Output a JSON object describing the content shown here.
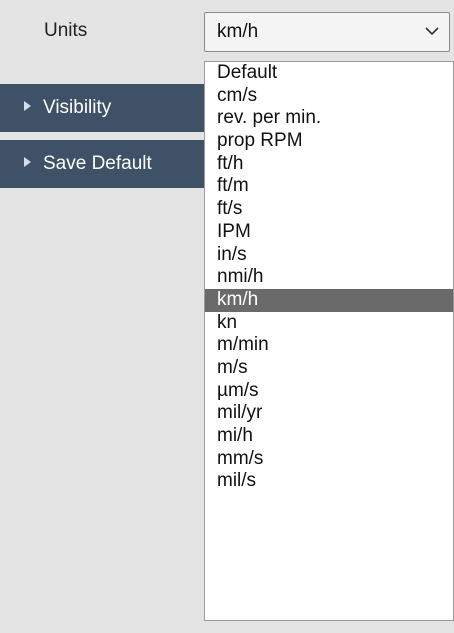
{
  "units": {
    "label": "Units",
    "selected": "km/h"
  },
  "sections": [
    {
      "label": "Visibility"
    },
    {
      "label": "Save Default"
    }
  ],
  "dropdown": {
    "options": [
      "Default",
      "cm/s",
      "rev. per min.",
      "prop RPM",
      "ft/h",
      "ft/m",
      "ft/s",
      "IPM",
      "in/s",
      "nmi/h",
      "km/h",
      "kn",
      "m/min",
      "m/s",
      "µm/s",
      "mil/yr",
      "mi/h",
      "mm/s",
      "mil/s"
    ],
    "selected_option": "km/h"
  },
  "colors": {
    "section_bg": "#3e5166",
    "selected_bg": "#6a6a6a",
    "page_bg": "#e4e4e4"
  }
}
